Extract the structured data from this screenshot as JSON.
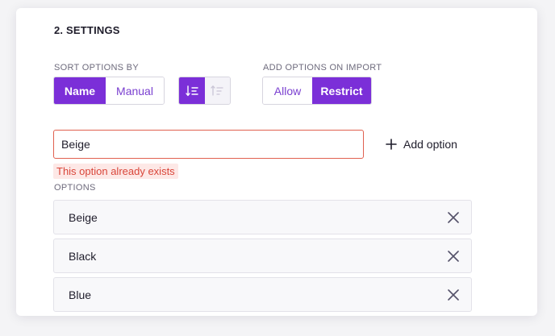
{
  "settings": {
    "title": "2. SETTINGS",
    "sort": {
      "label": "SORT OPTIONS BY",
      "options": [
        "Name",
        "Manual"
      ],
      "selected": "Name",
      "order_icons": [
        "sort-ascending-icon",
        "sort-descending-icon"
      ],
      "order_selected": "sort-ascending-icon"
    },
    "import": {
      "label": "ADD OPTIONS ON IMPORT",
      "options": [
        "Allow",
        "Restrict"
      ],
      "selected": "Restrict"
    },
    "new_option": {
      "value": "Beige",
      "add_label": "Add option",
      "error": "This option already exists"
    },
    "options": {
      "label": "OPTIONS",
      "items": [
        {
          "label": "Beige"
        },
        {
          "label": "Black"
        },
        {
          "label": "Blue"
        }
      ]
    }
  },
  "colors": {
    "accent": "#7b2fd8",
    "error": "#d9463a",
    "error_bg": "#fde8e6"
  }
}
